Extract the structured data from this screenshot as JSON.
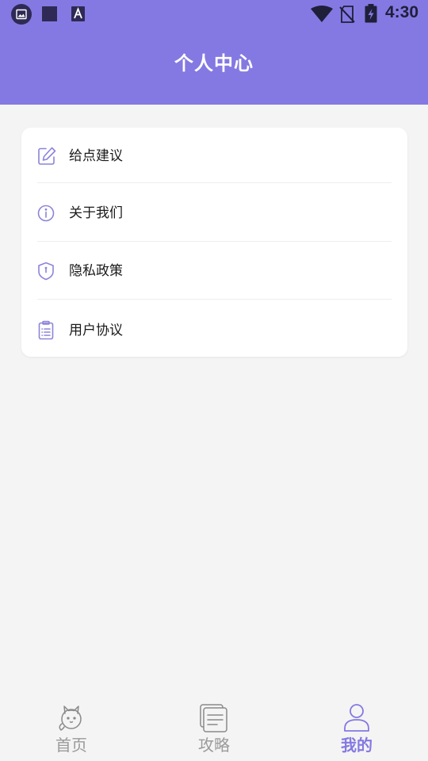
{
  "status_bar": {
    "time": "4:30",
    "left_icons": [
      "gallery-icon",
      "square-icon",
      "text-a-icon"
    ],
    "right_icons": [
      "wifi-icon",
      "no-sim-icon",
      "battery-charging-icon"
    ]
  },
  "header": {
    "title": "个人中心",
    "background_color": "#8479e2"
  },
  "menu": {
    "items": [
      {
        "label": "给点建议",
        "icon": "edit-icon"
      },
      {
        "label": "关于我们",
        "icon": "info-icon"
      },
      {
        "label": "隐私政策",
        "icon": "shield-icon"
      },
      {
        "label": "用户协议",
        "icon": "clipboard-icon"
      }
    ]
  },
  "tabbar": {
    "tabs": [
      {
        "label": "首页",
        "icon": "cat-icon",
        "active": false
      },
      {
        "label": "攻略",
        "icon": "pages-icon",
        "active": false
      },
      {
        "label": "我的",
        "icon": "user-icon",
        "active": true
      }
    ],
    "active_color": "#8479e2",
    "inactive_color": "#9a9a9a"
  }
}
